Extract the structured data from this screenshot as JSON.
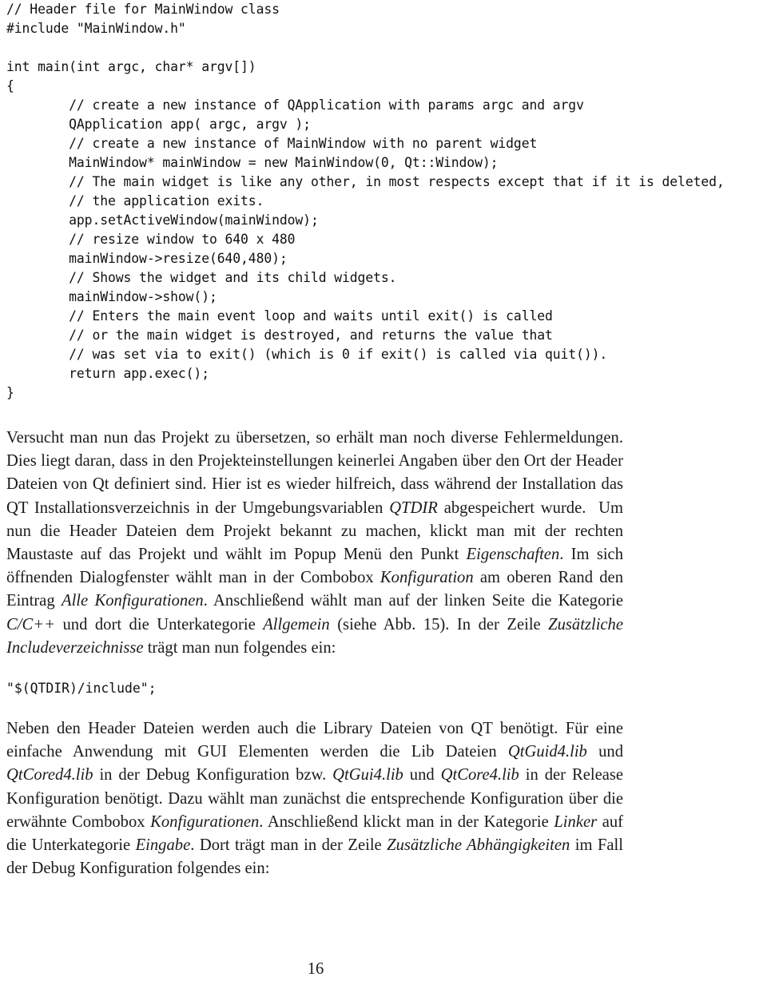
{
  "page": {
    "number": "16",
    "background_color": "#ffffff",
    "text_color": "#1a1a1a"
  },
  "code_listing": {
    "language": "cpp",
    "lines": [
      "// Header file for MainWindow class",
      "#include \"MainWindow.h\"",
      "",
      "int main(int argc, char* argv[])",
      "{",
      "        // create a new instance of QApplication with params argc and argv",
      "        QApplication app( argc, argv );",
      "        // create a new instance of MainWindow with no parent widget",
      "        MainWindow* mainWindow = new MainWindow(0, Qt::Window);",
      "        // The main widget is like any other, in most respects except that if it is deleted,",
      "        // the application exits.",
      "        app.setActiveWindow(mainWindow);",
      "        // resize window to 640 x 480",
      "        mainWindow->resize(640,480);",
      "        // Shows the widget and its child widgets.",
      "        mainWindow->show();",
      "        // Enters the main event loop and waits until exit() is called",
      "        // or the main widget is destroyed, and returns the value that",
      "        // was set via to exit() (which is 0 if exit() is called via quit()).",
      "        return app.exec();",
      "}"
    ]
  },
  "paragraph_1": {
    "html": "Versucht man nun das Projekt zu übersetzen, so erhält man noch diverse Fehlermeldungen. Dies liegt daran, dass in den Projekteinstellungen keinerlei Angaben über den Ort der Header Dateien von Qt definiert sind. Hier ist es wieder hilfreich, dass während der Installation das QT Installationsverzeichnis in der Umgebungsvariablen <i>QTDIR</i> abgespeichert wurde.&nbsp; Um nun die Header Dateien dem Projekt bekannt zu machen, klickt man mit der rechten Maustaste auf das Projekt und wählt im Popup Menü den Punkt <i>Eigenschaften</i>. Im sich öffnenden Dialogfenster wählt man in der Combobox <i>Konfiguration</i> am oberen Rand den Eintrag <i>Alle Konfigurationen</i>. Anschließend wählt man auf der linken Seite die Kategorie <i>C/C++</i> und dort die Unterkategorie <i>Allgemein</i> (siehe Abb. 15). In der Zeile <i>Zusätzliche Includeverzeichnisse</i> trägt man nun folgendes ein:"
  },
  "code_sample_1": {
    "text": "\"$(QTDIR)/include\";"
  },
  "paragraph_2": {
    "html": "Neben den Header Dateien werden auch die Library Dateien von QT benötigt. Für eine einfache Anwendung mit GUI Elementen werden die Lib Dateien <i>QtGuid4.lib</i> und <i>QtCored4.lib</i> in der Debug Konfiguration bzw. <i>QtGui4.lib</i> und <i>QtCore4.lib</i> in der Release Konfiguration benötigt. Dazu wählt man zunächst die entsprechende Konfiguration über die erwähnte Combobox <i>Konfigurationen</i>. Anschließend klickt man in der Kategorie <i>Linker</i> auf die Unterkategorie <i>Eingabe</i>. Dort trägt man in der Zeile <i>Zusätzliche Abhängigkeiten</i> im Fall der Debug Konfiguration folgendes ein:"
  }
}
